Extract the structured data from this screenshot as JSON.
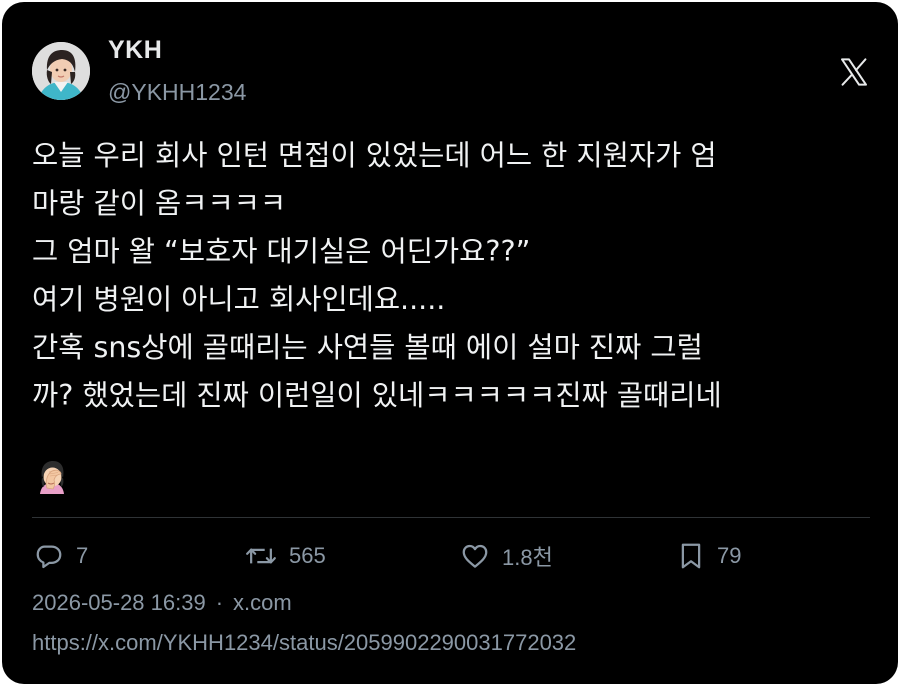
{
  "author": {
    "display_name": "YKH",
    "handle": "@YKHH1234"
  },
  "tweet": {
    "lines": [
      "오늘 우리 회사 인턴 면접이 있었는데 어느 한 지원자가 엄",
      "마랑 같이 옴ㅋㅋㅋㅋ",
      "그 엄마 왈 “보호자 대기실은 어딘가요??”",
      "여기 병원이 아니고 회사인데요.....",
      "간혹 sns상에 골때리는 사연들 볼때 에이 설마 진짜 그럴",
      "까? 했었는데 진짜 이런일이 있네ㅋㅋㅋㅋㅋ진짜 골때리네"
    ],
    "emoji": "woman-facepalming"
  },
  "actions": {
    "replies": "7",
    "retweets": "565",
    "likes": "1.8천",
    "bookmarks": "79"
  },
  "meta": {
    "timestamp": "2026-05-28 16:39",
    "separator": "·",
    "source": "x.com",
    "url": "https://x.com/YKHH1234/status/2059902290031772032"
  },
  "icons": {
    "brand": "x-logo-icon",
    "reply": "reply-icon",
    "retweet": "retweet-icon",
    "like": "heart-icon",
    "bookmark": "bookmark-icon"
  },
  "colors": {
    "background": "#000000",
    "text": "#e7e9ea",
    "secondary_text": "#8b98a5",
    "divider": "#2f3336"
  }
}
